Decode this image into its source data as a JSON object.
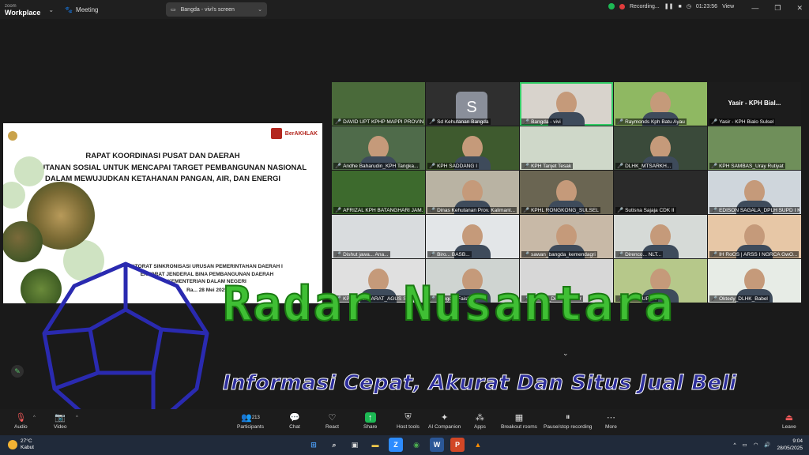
{
  "topbar": {
    "brand_small": "zoom",
    "brand_big": "Workplace",
    "meeting_label": "Meeting",
    "share_label": "Bangda - vivi's screen",
    "recording_label": "Recording...",
    "timer": "01:23:56",
    "view_label": "View"
  },
  "slide": {
    "brand_text": "BerAKHLAK",
    "title_1": "RAPAT KOORDINASI PUSAT DAN DAERAH",
    "title_2": "PERHUTANAN SOSIAL UNTUK MENCAPAI TARGET PEMBANGUNAN NASIONAL",
    "title_3": "DALAM MEWUJUDKAN KETAHANAN PANGAN, AIR, DAN ENERGI",
    "sub_1": "KTORAT SINKRONISASI URUSAN PEMERINTAHAN DAERAH I",
    "sub_2": "EKTORAT JENDERAL BINA PEMBANGUNAN DAERAH",
    "sub_3": "KEMENTERIAN DALAM NEGERI",
    "sub_4": "Ra... 28 Mei 2025"
  },
  "grid": {
    "tiles": [
      {
        "name": "DAVID UPT KPHP MAPPI PROVIN..."
      },
      {
        "name": "Sd Kehutanan Bangda",
        "initial": "S"
      },
      {
        "name": "Bangda - vivi"
      },
      {
        "name": "Raymonds Kph Batu Ayau"
      },
      {
        "name": "Yasir - KPH Bialo Sulsel",
        "top_name": "Yasir - KPH Bial..."
      },
      {
        "name": "Andhe Baharudin_KPH Tangka..."
      },
      {
        "name": "KPH SADDANG I"
      },
      {
        "name": "KPH Tanjet Tesak"
      },
      {
        "name": "DLHK_MTSARKH..."
      },
      {
        "name": "KPH SAMBAS_Uray Rutiyat"
      },
      {
        "name": "AFRIZAL KPH BATANGHARI JAM..."
      },
      {
        "name": "Dinas Kehutanan Prov. Kalimant..."
      },
      {
        "name": "KPHL RONGKONG_SULSEL"
      },
      {
        "name": "Sutisna Sajaja CDK II"
      },
      {
        "name": "EDISON SAGALA_DPLH SUPD I K..."
      },
      {
        "name": "Dishut jawa... Ana..."
      },
      {
        "name": "Biro... BASB..."
      },
      {
        "name": "sawan_bangda_kemendagri"
      },
      {
        "name": "Direnco... NLT..."
      },
      {
        "name": "IH RoOS | ARSS I NGRCA GwO..."
      },
      {
        "name": "KPH BALI BARAT_AGUS SG"
      },
      {
        "name": "Bangda_Faishal"
      },
      {
        "name": "Ibrahim_Dishut_Jabar"
      },
      {
        "name": "Heri - FUPUK"
      },
      {
        "name": "Oktedy_DLHK_Babel"
      }
    ]
  },
  "watermark": {
    "title": "Radar Nusantara",
    "subtitle": "Informasi Cepat, Akurat Dan Situs Jual Beli"
  },
  "toolbar": {
    "audio": "Audio",
    "video": "Video",
    "participants": "Participants",
    "participants_count": "213",
    "chat": "Chat",
    "react": "React",
    "share": "Share",
    "host_tools": "Host tools",
    "ai_companion": "AI Companion",
    "apps": "Apps",
    "breakout": "Breakout rooms",
    "pause_rec": "Pause/stop recording",
    "more": "More",
    "leave": "Leave"
  },
  "taskbar": {
    "temp": "27°C",
    "weather": "Kabut",
    "time": "9:04",
    "date": "28/05/2025"
  }
}
